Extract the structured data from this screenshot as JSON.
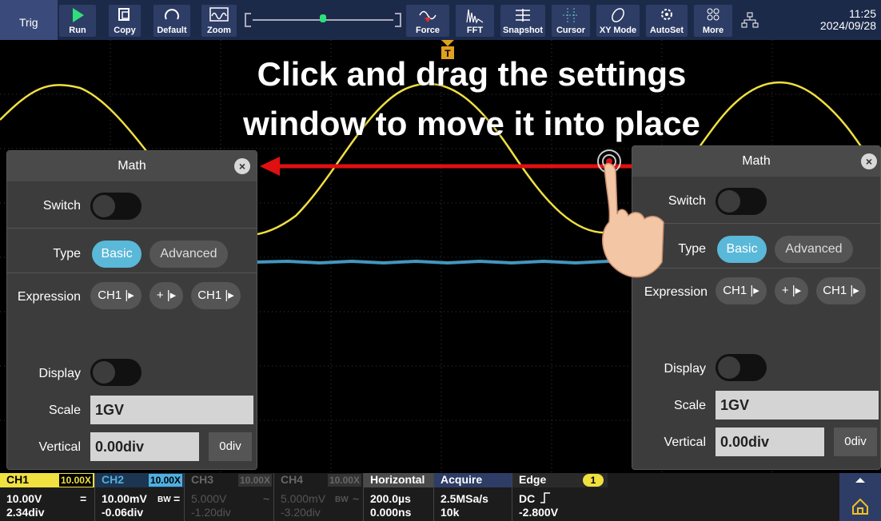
{
  "toolbar": {
    "trig_label": "Trig",
    "buttons": [
      "Run",
      "Copy",
      "Default",
      "Zoom",
      "Force",
      "FFT",
      "Snapshot",
      "Cursor",
      "XY Mode",
      "AutoSet",
      "More"
    ],
    "time": "11:25",
    "date": "2024/09/28"
  },
  "headline": {
    "line1": "Click and drag the settings",
    "line2": "window to move it into place"
  },
  "trigger_marker": "T",
  "math_panel": {
    "title": "Math",
    "close_glyph": "×",
    "switch_label": "Switch",
    "type_label": "Type",
    "type_options": [
      "Basic",
      "Advanced"
    ],
    "type_selected": "Basic",
    "expression_label": "Expression",
    "expression": [
      "CH1 |▸",
      "+ |▸",
      "CH1 |▸"
    ],
    "display_label": "Display",
    "scale_label": "Scale",
    "scale_value": "1GV",
    "vertical_label": "Vertical",
    "vertical_value": "0.00div",
    "vertical_reset": "0div"
  },
  "status": {
    "ch1": {
      "name": "CH1",
      "badge": "10.00X",
      "line1": "10.00V",
      "coupling": "=",
      "line2": "2.34div"
    },
    "ch2": {
      "name": "CH2",
      "badge": "10.00X",
      "line1": "10.00mV",
      "bw": "BW",
      "coupling": "=",
      "line2": "-0.06div"
    },
    "ch3": {
      "name": "CH3",
      "badge": "10.00X",
      "line1": "5.000V",
      "coupling": "~",
      "line2": "-1.20div"
    },
    "ch4": {
      "name": "CH4",
      "badge": "10.00X",
      "line1": "5.000mV",
      "bw": "BW",
      "coupling": "~",
      "line2": "-3.20div"
    },
    "horizontal": {
      "name": "Horizontal",
      "line1": "200.0µs",
      "line2": "0.000ns"
    },
    "acquire": {
      "name": "Acquire",
      "line1": "2.5MSa/s",
      "line2": "10k"
    },
    "trigger": {
      "name": "Edge",
      "badge": "1",
      "line1": "DC",
      "line2": "-2.800V"
    }
  },
  "colors": {
    "ch1": "#f0e040",
    "ch2": "#4fb0e0",
    "accent": "#5ab8d8",
    "arrow": "#e01010"
  }
}
